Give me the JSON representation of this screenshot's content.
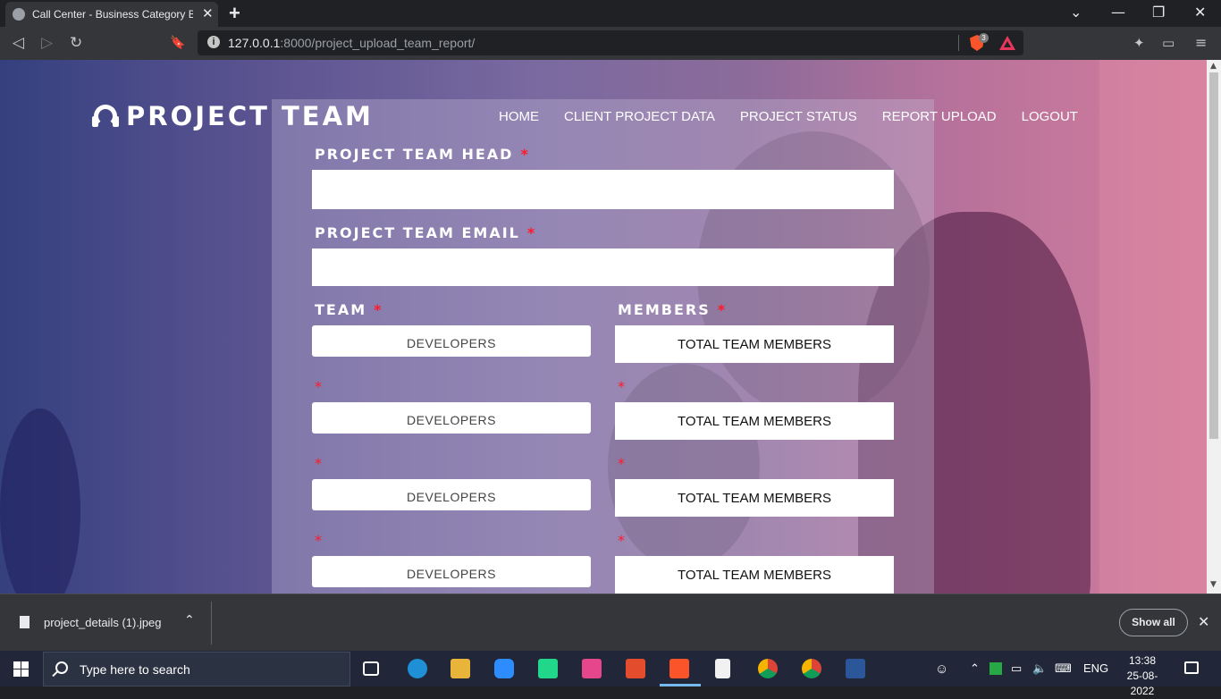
{
  "browser": {
    "tab_title": "Call Center - Business Category B",
    "tab_close": "✕",
    "new_tab": "+",
    "url_host": "127.0.0.1",
    "url_rest": ":8000/project_upload_team_report/",
    "shield_count": "3",
    "window_controls": {
      "list": "⌄",
      "minimize": "—",
      "restore": "❐",
      "close": "✕"
    },
    "nav_buttons": {
      "back": "◁",
      "forward": "▷",
      "reload": "↻",
      "bookmark": "🔖"
    }
  },
  "site": {
    "logo_text": "PROJECT TEAM",
    "nav": [
      "HOME",
      "CLIENT PROJECT DATA",
      "PROJECT STATUS",
      "REPORT UPLOAD",
      "LOGOUT"
    ]
  },
  "form": {
    "head_label": "PROJECT TEAM HEAD",
    "email_label": "PROJECT TEAM EMAIL",
    "team_label": "TEAM",
    "members_label": "MEMBERS",
    "required_mark": "*",
    "team_rows": [
      {
        "team": "DEVELOPERS",
        "members_placeholder": "TOTAL TEAM MEMBERS"
      },
      {
        "team": "DEVELOPERS",
        "members_placeholder": "TOTAL TEAM MEMBERS"
      },
      {
        "team": "DEVELOPERS",
        "members_placeholder": "TOTAL TEAM MEMBERS"
      },
      {
        "team": "DEVELOPERS",
        "members_placeholder": "TOTAL TEAM MEMBERS"
      }
    ]
  },
  "downloads": {
    "file_name": "project_details (1).jpeg",
    "show_all": "Show all",
    "close": "✕",
    "chevron": "⌃"
  },
  "taskbar": {
    "search_placeholder": "Type here to search",
    "language": "ENG",
    "time": "13:38",
    "date": "25-08-2022",
    "tray_up": "⌃"
  }
}
